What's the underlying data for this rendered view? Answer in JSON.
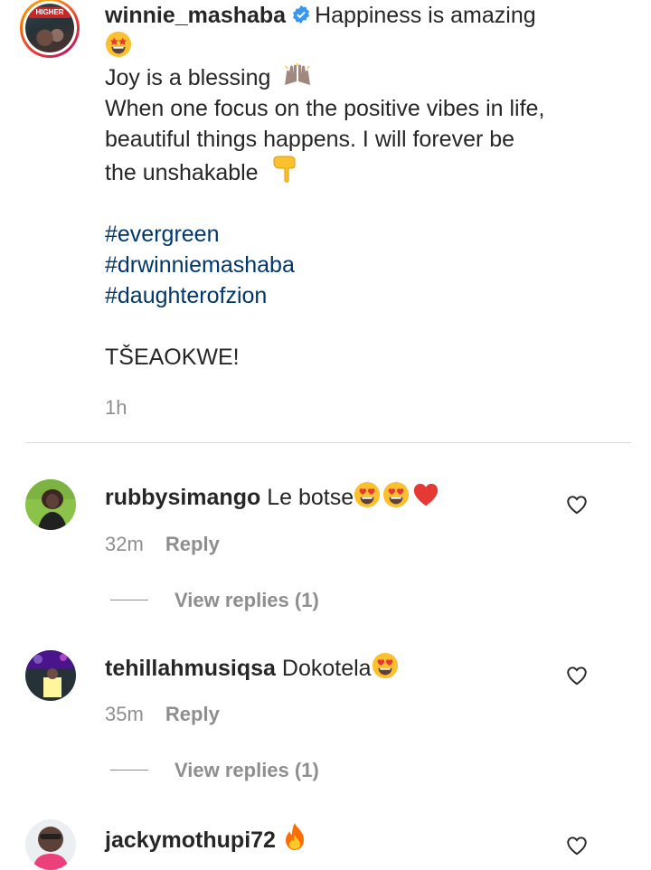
{
  "post": {
    "username": "winnie_mashaba",
    "caption_first": "Happiness is amazing",
    "line_joy": "Joy is a blessing",
    "line_focus": "When one focus on the positive vibes in life,",
    "line_beautiful": "beautiful things happens. I will forever be",
    "line_unshakable": "the unshakable",
    "hashtags": [
      "#evergreen",
      "#drwinniemashaba",
      "#daughterofzion"
    ],
    "signoff": "TŠEAOKWE!",
    "time": "1h"
  },
  "comments": [
    {
      "username": "rubbysimango",
      "text": "Le botse",
      "time": "32m",
      "reply_label": "Reply",
      "view_replies": "View replies (1)"
    },
    {
      "username": "tehillahmusiqsa",
      "text": "Dokotela",
      "time": "35m",
      "reply_label": "Reply",
      "view_replies": "View replies (1)"
    },
    {
      "username": "jackymothupi72",
      "text": ""
    }
  ],
  "icons": [
    "verified-badge-icon",
    "star-struck-emoji-icon",
    "raising-hands-emoji-icon",
    "pointing-down-emoji-icon",
    "heart-eyes-emoji-icon",
    "red-heart-emoji-icon",
    "fire-emoji-icon",
    "like-heart-icon"
  ],
  "colors": {
    "hashtag": "#00376b",
    "verified": "#3897f0",
    "meta": "#8e8e8e"
  }
}
